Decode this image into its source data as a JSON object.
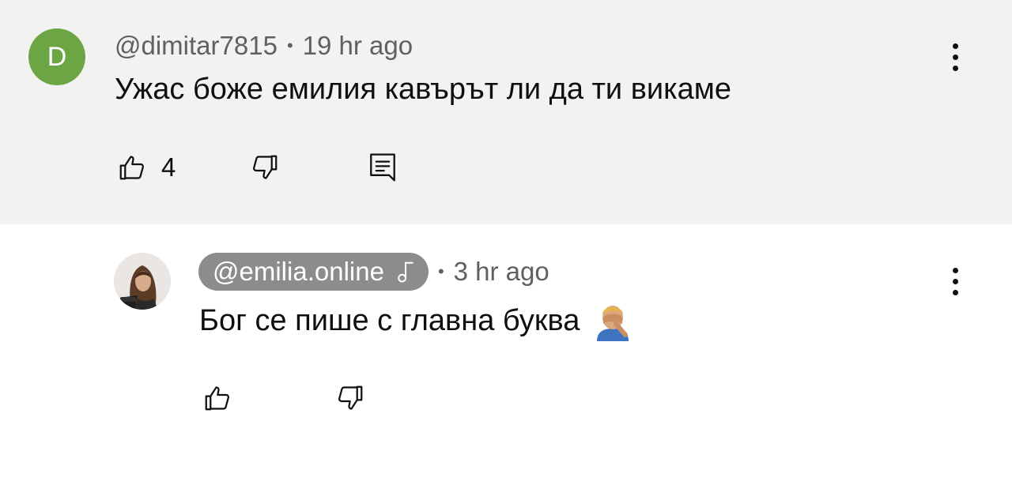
{
  "comments": [
    {
      "avatar": {
        "letter": "D",
        "color": "#6ca543"
      },
      "author": "@dimitar7815",
      "separator": "•",
      "time": "19 hr ago",
      "text": "Ужас боже емилия кавърът ли да ти викаме",
      "like_count": "4",
      "icons": [
        "like-icon",
        "dislike-icon",
        "reply-icon",
        "more-vert-icon"
      ]
    },
    {
      "avatar": {
        "type": "photo"
      },
      "author": "@emilia.online",
      "author_badge": "music-note-icon",
      "author_chip_color": "#8c8c8c",
      "separator": "•",
      "time": "3 hr ago",
      "text": "Бог се пише с главна буква",
      "emoji": "facepalm-emoji",
      "icons": [
        "like-icon",
        "dislike-icon",
        "more-vert-icon"
      ]
    }
  ]
}
